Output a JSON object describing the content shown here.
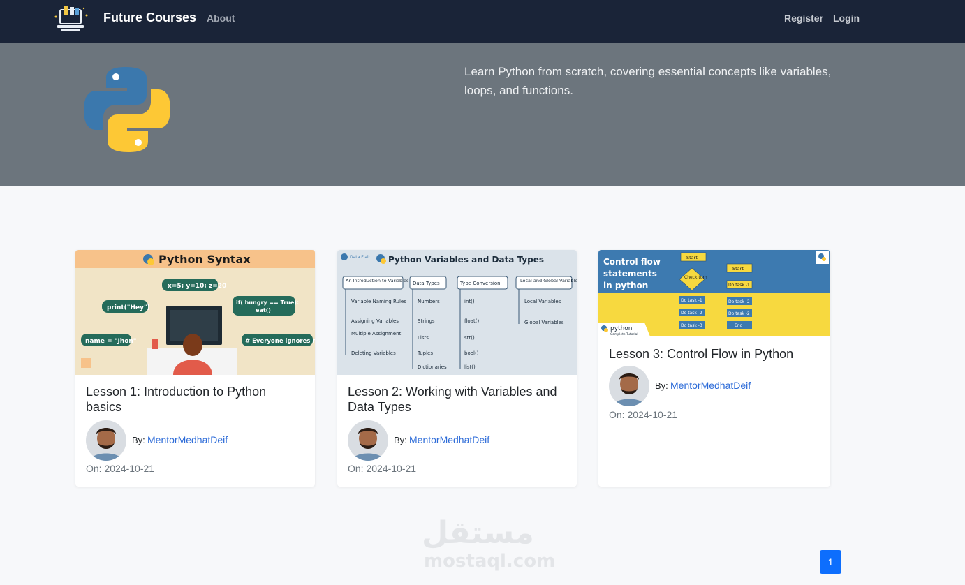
{
  "navbar": {
    "brand": "Future Courses",
    "about": "About",
    "register": "Register",
    "login": "Login",
    "background": "#1a2438"
  },
  "hero": {
    "description": "Learn Python from scratch, covering essential concepts like variables, loops, and functions.",
    "background": "#6c757d",
    "logo_icon": "python-logo-icon"
  },
  "lessons": [
    {
      "title": "Lesson 1: Introduction to Python basics",
      "thumb": {
        "heading": "Python Syntax",
        "bubble_1": "x=5; y=10; z=20",
        "bubble_2": "print(\"Hey\")",
        "bubble_3": "if( hungry == True):",
        "bubble_3b": "eat()",
        "bubble_4": "name = \"Jhon\"",
        "bubble_5": "# Everyone ignores me"
      },
      "by_label": "By:",
      "author": "MentorMedhatDeif",
      "date": "On: 2024-10-21"
    },
    {
      "title": "Lesson 2: Working with Variables and Data Types",
      "thumb": {
        "heading": "Python Variables and Data Types",
        "corner": "Data Flair",
        "col_1_head": "An Introduction to Variables",
        "col_1": [
          "Variable Naming Rules",
          "Assigning Variables",
          "Multiple Assignment",
          "Deleting Variables"
        ],
        "col_2_head": "Data Types",
        "col_2": [
          "Numbers",
          "Strings",
          "Lists",
          "Tuples",
          "Dictionaries"
        ],
        "col_3_head": "Type Conversion",
        "col_3": [
          "int()",
          "float()",
          "str()",
          "bool()",
          "list()"
        ],
        "col_4_head": "Local and Global Variables",
        "col_4": [
          "Local Variables",
          "Global Variables"
        ]
      },
      "by_label": "By:",
      "author": "MentorMedhatDeif",
      "date": "On: 2024-10-21"
    },
    {
      "title": "Lesson 3: Control Flow in Python",
      "thumb": {
        "heading_1": "Control flow",
        "heading_2": "statements",
        "heading_3": "in python",
        "flow_a": [
          "Start",
          "Check turn",
          "Do task -1",
          "Do task -2",
          "Do task -3"
        ],
        "flow_b": [
          "Start",
          "Do task -1",
          "Do task -2",
          "Do task -2",
          "End"
        ],
        "badge": "python",
        "badge_sub": "Complete Tutorial"
      },
      "by_label": "By:",
      "author": "MentorMedhatDeif",
      "date": "On: 2024-10-21"
    }
  ],
  "watermark": {
    "arabic": "مستقل",
    "latin": "mostaql.com"
  },
  "pagination": {
    "current": "1"
  },
  "colors": {
    "link": "#2c6bd8",
    "page_button": "#0d6efd",
    "python_blue": "#3b78ad",
    "python_yellow": "#fdc835"
  }
}
